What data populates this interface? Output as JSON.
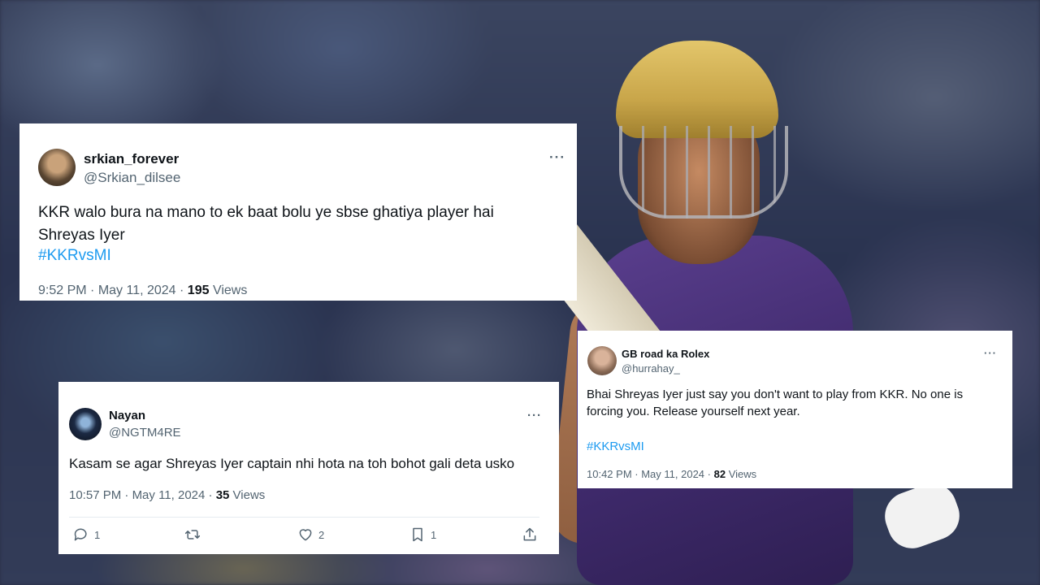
{
  "tweets": [
    {
      "display_name": "srkian_forever",
      "handle": "@Srkian_dilsee",
      "text": "KKR walo bura na mano to ek baat bolu ye sbse ghatiya player hai Shreyas Iyer",
      "hashtag": "#KKRvsMI",
      "time": "9:52 PM",
      "date": "May 11, 2024",
      "views": "195",
      "views_label": "Views",
      "more": "···"
    },
    {
      "display_name": "Nayan",
      "handle": "@NGTM4RE",
      "text": "Kasam se agar Shreyas Iyer captain nhi hota na toh bohot gali deta usko",
      "time": "10:57 PM",
      "date": "May 11, 2024",
      "views": "35",
      "views_label": "Views",
      "more": "···",
      "actions": {
        "replies": "1",
        "reposts": "",
        "likes": "2",
        "bookmarks": "1"
      }
    },
    {
      "display_name": "GB road ka Rolex",
      "handle": "@hurrahay_",
      "text": "Bhai Shreyas Iyer just say you don't want to play from KKR. No one is forcing you. Release yourself next year.",
      "hashtag": "#KKRvsMI",
      "time": "10:42 PM",
      "date": "May 11, 2024",
      "views": "82",
      "views_label": "Views",
      "more": "···"
    }
  ],
  "separator": " · ",
  "icons": [
    "reply-icon",
    "repost-icon",
    "like-icon",
    "bookmark-icon",
    "share-icon",
    "more-icon"
  ],
  "colors": {
    "link": "#1d9bf0",
    "secondary": "#536471",
    "text": "#0f1419"
  }
}
